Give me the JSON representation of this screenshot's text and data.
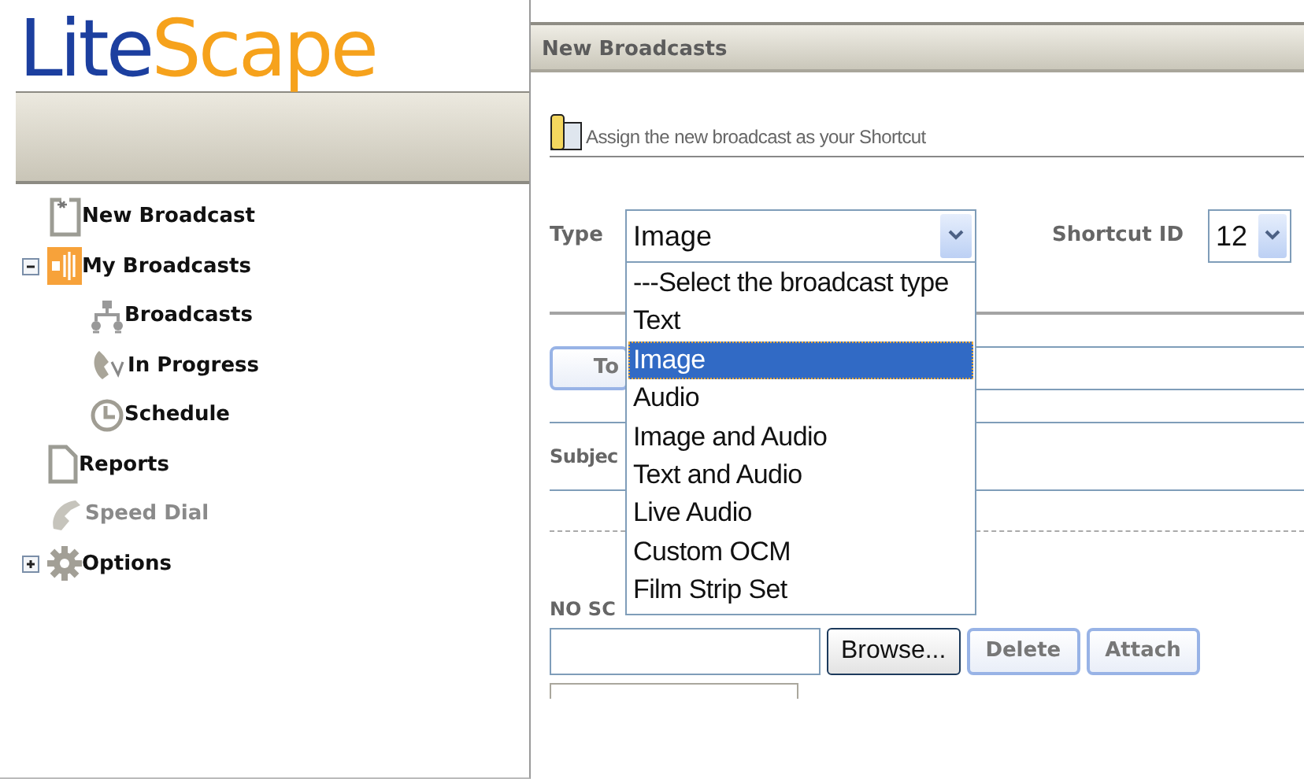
{
  "logo": [
    {
      "text": "Lite",
      "color": "#1c3f9f"
    },
    {
      "text": "Scape",
      "color": "#f6a21c"
    }
  ],
  "sidebar": {
    "items": [
      {
        "kind": "new",
        "label": "New Broadcast",
        "disabled": false
      },
      {
        "kind": "broadcasts",
        "label": "My Broadcasts",
        "disabled": false,
        "expanded": true,
        "children": [
          {
            "kind": "network",
            "label": "Broadcasts",
            "disabled": false
          },
          {
            "kind": "progress",
            "label": "In Progress",
            "disabled": false
          },
          {
            "kind": "schedule",
            "label": "Schedule",
            "disabled": false
          }
        ]
      },
      {
        "kind": "reports",
        "label": "Reports",
        "disabled": false
      },
      {
        "kind": "speed-dial",
        "label": "Speed Dial",
        "disabled": true
      },
      {
        "kind": "options",
        "label": "Options",
        "disabled": false,
        "expanded": false
      }
    ]
  },
  "panel": {
    "title": "New Broadcasts",
    "shortcut_note": "Assign the new broadcast as your Shortcut",
    "type_label": "Type",
    "type_value": "Image",
    "shortcut_id_label": "Shortcut ID",
    "shortcut_id_value": "12",
    "to_button": "To",
    "subject_label": "Subjec",
    "schedule_label": "NO SC",
    "buttons": [
      {
        "label": "Browse...",
        "kind": "browse"
      },
      {
        "label": "Delete",
        "kind": "action"
      },
      {
        "label": "Attach",
        "kind": "action"
      }
    ],
    "type_options": [
      {
        "label": "---Select the broadcast type",
        "selected": false
      },
      {
        "label": "Text",
        "selected": false
      },
      {
        "label": "Image",
        "selected": true
      },
      {
        "label": "Audio",
        "selected": false
      },
      {
        "label": "Image and Audio",
        "selected": false
      },
      {
        "label": "Text and Audio",
        "selected": false
      },
      {
        "label": "Live Audio",
        "selected": false
      },
      {
        "label": "Custom OCM",
        "selected": false
      },
      {
        "label": "Film Strip Set",
        "selected": false
      }
    ]
  }
}
